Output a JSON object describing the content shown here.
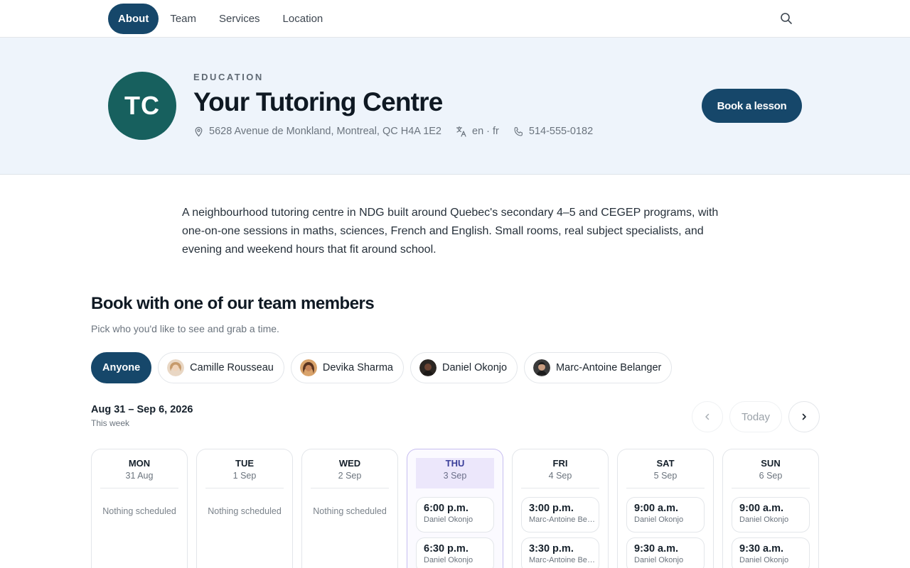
{
  "nav": {
    "items": [
      {
        "label": "About",
        "active": true
      },
      {
        "label": "Team",
        "active": false
      },
      {
        "label": "Services",
        "active": false
      },
      {
        "label": "Location",
        "active": false
      }
    ],
    "search_icon": "search-icon"
  },
  "hero": {
    "logo_initials": "TC",
    "logo_color": "#17605e",
    "category": "EDUCATION",
    "title": "Your Tutoring Centre",
    "address": "5628 Avenue de Monkland, Montreal, QC H4A 1E2",
    "languages": "en · fr",
    "phone": "514-555-0182",
    "book_label": "Book a lesson",
    "accent_color": "#16476a"
  },
  "description": "A neighbourhood tutoring centre in NDG built around Quebec's secondary 4–5 and CEGEP programs, with one-on-one sessions in maths, sciences, French and English. Small rooms, real subject specialists, and evening and weekend hours that fit around school.",
  "booking": {
    "title": "Book with one of our team members",
    "subtitle": "Pick who you'd like to see and grab a time.",
    "staff": [
      {
        "label": "Anyone",
        "active": true
      },
      {
        "label": "Camille Rousseau",
        "active": false
      },
      {
        "label": "Devika Sharma",
        "active": false
      },
      {
        "label": "Daniel Okonjo",
        "active": false
      },
      {
        "label": "Marc-Antoine Belanger",
        "active": false
      }
    ],
    "range": "Aug 31 – Sep 6, 2026",
    "range_sub": "This week",
    "today_label": "Today",
    "empty_label": "Nothing scheduled",
    "days": [
      {
        "name": "MON",
        "date": "31 Aug",
        "today": false,
        "slots": []
      },
      {
        "name": "TUE",
        "date": "1 Sep",
        "today": false,
        "slots": []
      },
      {
        "name": "WED",
        "date": "2 Sep",
        "today": false,
        "slots": []
      },
      {
        "name": "THU",
        "date": "3 Sep",
        "today": true,
        "slots": [
          {
            "time": "6:00 p.m.",
            "who": "Daniel Okonjo"
          },
          {
            "time": "6:30 p.m.",
            "who": "Daniel Okonjo"
          }
        ]
      },
      {
        "name": "FRI",
        "date": "4 Sep",
        "today": false,
        "slots": [
          {
            "time": "3:00 p.m.",
            "who": "Marc-Antoine Belanger"
          },
          {
            "time": "3:30 p.m.",
            "who": "Marc-Antoine Belanger"
          }
        ]
      },
      {
        "name": "SAT",
        "date": "5 Sep",
        "today": false,
        "slots": [
          {
            "time": "9:00 a.m.",
            "who": "Daniel Okonjo"
          },
          {
            "time": "9:30 a.m.",
            "who": "Daniel Okonjo"
          }
        ]
      },
      {
        "name": "SUN",
        "date": "6 Sep",
        "today": false,
        "slots": [
          {
            "time": "9:00 a.m.",
            "who": "Daniel Okonjo"
          },
          {
            "time": "9:30 a.m.",
            "who": "Daniel Okonjo"
          }
        ]
      }
    ]
  }
}
